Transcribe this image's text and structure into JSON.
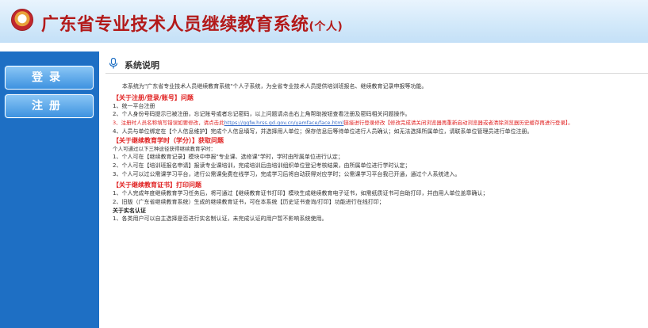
{
  "header": {
    "title": "广东省专业技术人员继续教育系统",
    "subtitle": "(个人)"
  },
  "sidebar": {
    "items": [
      {
        "label": "登录"
      },
      {
        "label": "注册"
      }
    ]
  },
  "main": {
    "title": "系统说明",
    "intro": "本系统为\"广东省专业技术人员继续教育系统\"个人子系统，为全省专业技术人员提供培训班报名、继续教育记录申报等功能。",
    "sec1": {
      "heading": "【关于注册/登录/账号】问题",
      "items": [
        "1、统一平台注册",
        "2、个人身份号码提示已被注册，忘记账号或者忘记密码，以上问题请点击右上角帮助按钮查看注册及密码相关问题操作。",
        "4、人员与单位绑定在【个人信息维护】完成个人信息填写，并选择用人单位；保存信息后等待单位进行人员确认；如无法选择所属单位，请联系单位管理员进行单位注册。"
      ],
      "item3_a": "3、注册时人员名称填写错误如要修改，请点击此",
      "item3_link": "https://ggfw.hrss.gd.gov.cn/yamface/face.html",
      "item3_b": "链接进行登录修改【修改完成请关闭浏览器再重新启动浏览器或者清除浏览器历史缓存再进行登录】。"
    },
    "sec2": {
      "heading": "【关于继续教育学时（学分）】获取问题",
      "note": "个人可通过以下三种途径获得继续教育学时：",
      "items": [
        "1、个人可在【继续教育记录】模块中申报\"专业课、选修课\"学时，学时由所属单位进行认定；",
        "2、个人可在【培训班报名申请】报读专业课培训，完成培训后由培训组织单位登记考核结果，由所属单位进行学时认定；",
        "3、个人可以过公需课学习平台，进行公需课免费在线学习，完成学习后将自动获得对应学时；公需课学习平台我已开通，通过个人系统进入。"
      ]
    },
    "sec3": {
      "heading": "【关于继续教育证书】打印问题",
      "items": [
        "1、个人完成年度继续教育学习任务后，将可通过【继续教育证书打印】模块生成继续教育电子证书，如需纸质证书可自助打印，并由用人单位盖章确认；",
        "2、旧版（广东省继续教育系统）生成的继续教育证书，可在本系统【历史证书查询/打印】功能进行在线打印；"
      ]
    },
    "sec4": {
      "heading": "关于实名认证",
      "items": [
        "1、各类用户可以自主选择是否进行实名制认证，未完成认证的用户暂不影响系统使用。"
      ]
    }
  }
}
